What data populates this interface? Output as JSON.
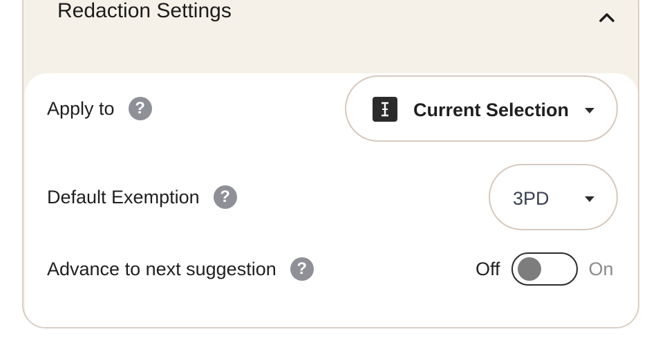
{
  "header": {
    "title": "Redaction Settings",
    "collapse_icon": "chevron-up-icon"
  },
  "apply_to": {
    "label": "Apply to",
    "help_glyph": "?",
    "value": "Current Selection",
    "icon": "text-cursor-icon"
  },
  "default_exemption": {
    "label": "Default Exemption",
    "help_glyph": "?",
    "value": "3PD"
  },
  "advance": {
    "label": "Advance to next suggestion",
    "help_glyph": "?",
    "off_label": "Off",
    "on_label": "On",
    "state": "off"
  },
  "colors": {
    "panel_background": "#f6f1e8",
    "border": "#d5c9bf",
    "help_icon": "#8f9097"
  }
}
